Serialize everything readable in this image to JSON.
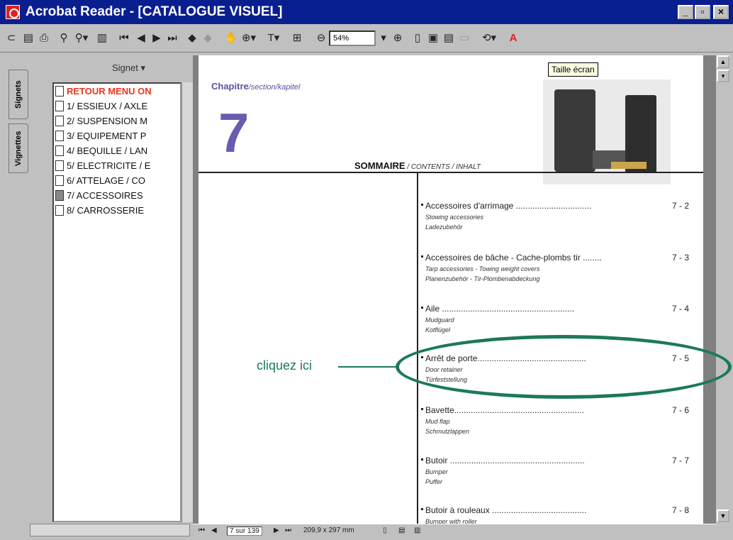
{
  "window": {
    "title": "Acrobat Reader - [CATALOGUE VISUEL]",
    "controls": [
      "_",
      "▫",
      "×"
    ]
  },
  "toolbar": {
    "zoom_value": "54%",
    "icons": [
      "open-icon",
      "save-icon",
      "print-icon",
      "find-icon",
      "search-icon",
      "thumbnails-icon",
      "first-page-icon",
      "prev-page-icon",
      "next-page-icon",
      "last-page-icon",
      "back-icon",
      "forward-icon",
      "hand-icon",
      "zoom-icon",
      "text-select-icon",
      "graphics-select-icon",
      "zoom-out-icon",
      "zoom-in-icon",
      "actual-size-icon",
      "fit-page-icon",
      "fit-width-icon",
      "reflow-icon",
      "rotate-icon",
      "acrobat-icon"
    ]
  },
  "nav": {
    "signet_label": "Signet ▾",
    "tabs": [
      "Signets",
      "Vignettes"
    ],
    "bookmarks": [
      {
        "label": "RETOUR MENU ON",
        "red": true
      },
      {
        "label": "1/ ESSIEUX / AXLE"
      },
      {
        "label": "2/ SUSPENSION M"
      },
      {
        "label": "3/ EQUIPEMENT P"
      },
      {
        "label": "4/ BEQUILLE / LAN"
      },
      {
        "label": "5/ ELECTRICITE / E"
      },
      {
        "label": "6/ ATTELAGE / CO"
      },
      {
        "label": "7/ ACCESSOIRES",
        "active": true
      },
      {
        "label": "8/ CARROSSERIE"
      }
    ]
  },
  "page": {
    "chapitre": "Chapitre",
    "chapitre_sub": "/section/kapitel",
    "chapter_number": "7",
    "sommaire": "SOMMAIRE",
    "sommaire_sub": " / CONTENTS / INHALT",
    "tooltip": "Taille écran",
    "toc": [
      {
        "title": "Accessoires d'arrimage ................................",
        "page": "7 - 2",
        "en": "Stowing accessories",
        "de": "Ladezubehör"
      },
      {
        "title": "Accessoires de bâche - Cache-plombs tir ........",
        "page": "7 - 3",
        "en": "Tarp accessories - Towing weight covers",
        "de": "Planenzubehör - Tir-Plombenabdeckung"
      },
      {
        "title": "Aile ........................................................",
        "page": "7 - 4",
        "en": "Mudguard",
        "de": "Kotflügel"
      },
      {
        "title": "Arrêt de porte..............................................",
        "page": "7 - 5",
        "en": "Door retainer",
        "de": "Türfeststellung"
      },
      {
        "title": "Bavette.......................................................",
        "page": "7 - 6",
        "en": "Mud flap",
        "de": "Schmutzlappen"
      },
      {
        "title": "Butoir .........................................................",
        "page": "7 - 7",
        "en": "Bumper",
        "de": "Puffer"
      },
      {
        "title": "Butoir à rouleaux ........................................",
        "page": "7 - 8",
        "en": "Bumper with roller",
        "de": ""
      }
    ]
  },
  "statusbar": {
    "page_indicator": "7 sur 139",
    "page_size": "209,9 x 297 mm"
  },
  "annotation": {
    "label": "cliquez ici",
    "color": "#1b7a55"
  }
}
